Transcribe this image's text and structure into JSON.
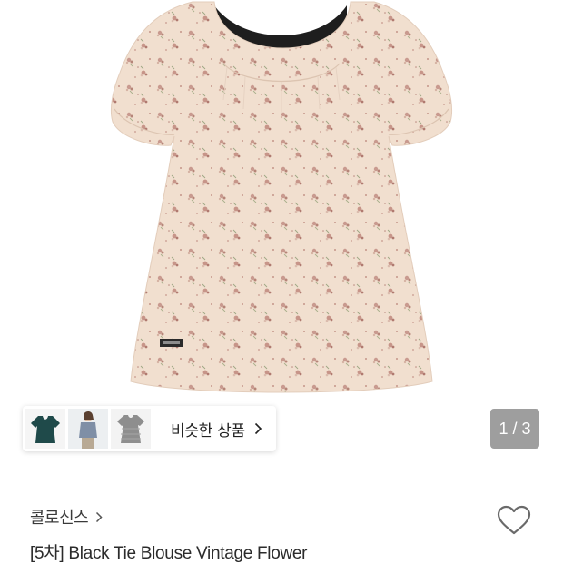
{
  "similar_products": {
    "label": "비슷한 상품",
    "thumbnails": [
      "teal-blouse-thumbnail",
      "model-blouse-thumbnail",
      "gray-blouse-thumbnail"
    ]
  },
  "image_counter": {
    "text": "1 / 3",
    "current": 1,
    "total": 3
  },
  "brand": {
    "name": "콜로신스"
  },
  "product": {
    "title": "[5차] Black Tie Blouse Vintage Flower"
  },
  "icons": {
    "brand_chevron": "chevron-right-icon",
    "similar_chevron": "chevron-right-icon",
    "wishlist": "heart-outline-icon"
  },
  "colors": {
    "fabric": "#f1dfcf",
    "floral": "#c7998d",
    "lining": "#1e1e1e",
    "counter_bg": "#8a8a8a"
  }
}
